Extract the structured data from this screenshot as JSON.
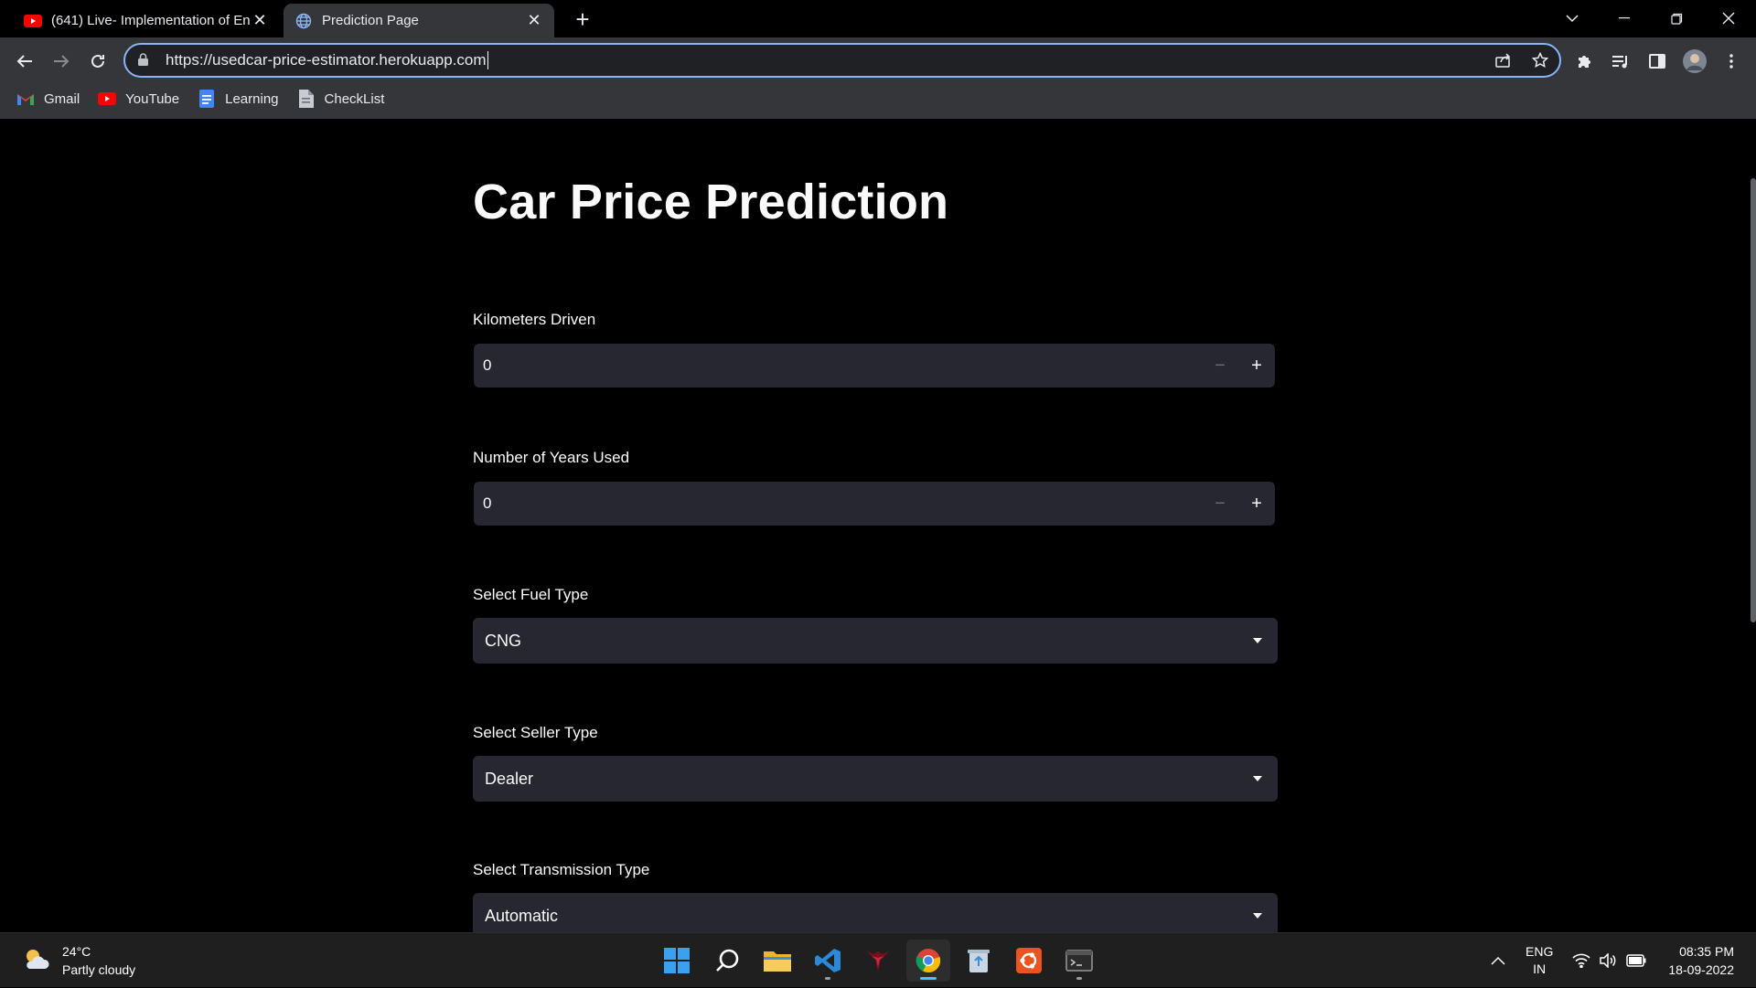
{
  "browser": {
    "tabs": [
      {
        "title": "(641) Live- Implementation of En",
        "icon": "youtube-icon"
      },
      {
        "title": "Prediction Page",
        "icon": "globe-icon"
      }
    ],
    "url": "https://usedcar-price-estimator.herokuapp.com",
    "bookmarks": [
      {
        "label": "Gmail",
        "icon": "gmail-icon"
      },
      {
        "label": "YouTube",
        "icon": "youtube-icon"
      },
      {
        "label": "Learning",
        "icon": "docs-icon"
      },
      {
        "label": "CheckList",
        "icon": "document-icon"
      }
    ]
  },
  "page": {
    "title": "Car Price Prediction",
    "fields": {
      "km": {
        "label": "Kilometers Driven",
        "value": "0"
      },
      "years": {
        "label": "Number of Years Used",
        "value": "0"
      },
      "fuel": {
        "label": "Select Fuel Type",
        "value": "CNG"
      },
      "seller": {
        "label": "Select Seller Type",
        "value": "Dealer"
      },
      "transmission": {
        "label": "Select Transmission Type",
        "value": "Automatic"
      }
    }
  },
  "taskbar": {
    "weather": {
      "temp": "24°C",
      "desc": "Partly cloudy"
    },
    "lang": {
      "line1": "ENG",
      "line2": "IN"
    },
    "time": "08:35 PM",
    "date": "18-09-2022"
  },
  "colors": {
    "accent": "#8ab4f8",
    "input_bg": "#262730",
    "page_bg": "#000000"
  }
}
